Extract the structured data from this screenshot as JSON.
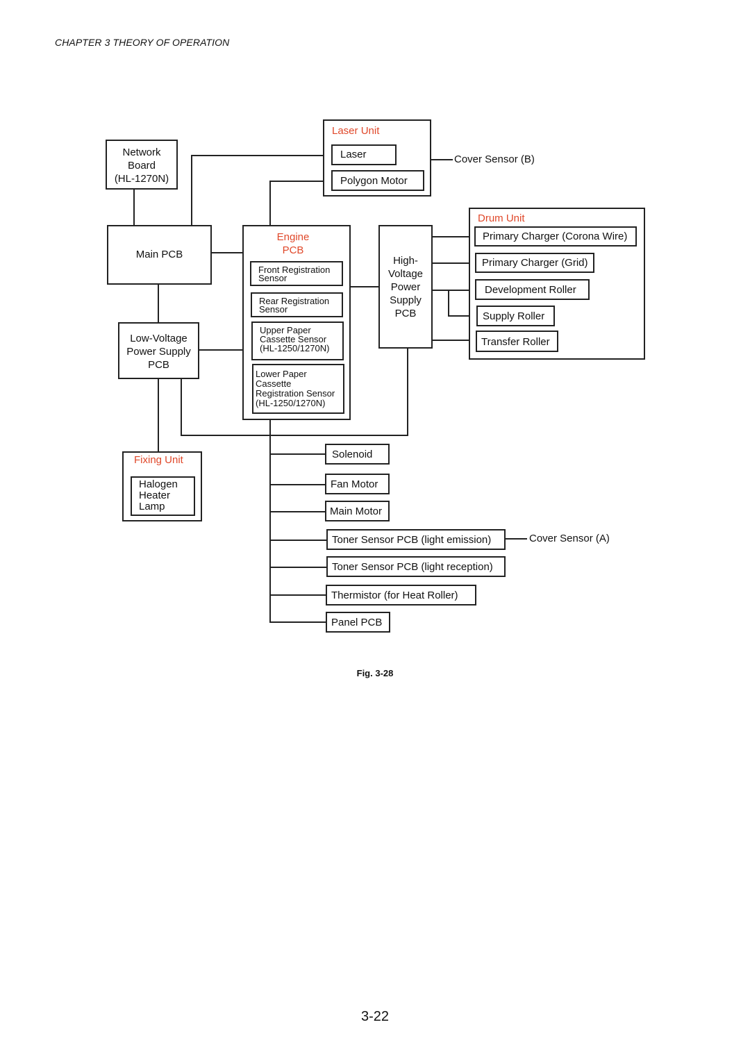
{
  "page": {
    "header": "CHAPTER 3  THEORY OF OPERATION",
    "figure_caption": "Fig. 3-28",
    "page_number": "3-22"
  },
  "colors": {
    "group_label": "#e0482a",
    "line": "#222222"
  },
  "diagram": {
    "network_board": [
      "Network",
      "Board",
      "(HL-1270N)"
    ],
    "main_pcb": "Main PCB",
    "low_voltage_psu": [
      "Low-Voltage",
      "Power Supply",
      "PCB"
    ],
    "fixing_unit": {
      "label": "Fixing Unit",
      "halogen_lamp": [
        "Halogen",
        "Heater",
        "Lamp"
      ]
    },
    "laser_unit": {
      "label": "Laser Unit",
      "laser": "Laser",
      "polygon_motor": "Polygon Motor"
    },
    "cover_sensor_b": "Cover Sensor (B)",
    "engine_pcb": {
      "label": [
        "Engine",
        "PCB"
      ],
      "sensors": [
        [
          "Front Registration",
          "Sensor"
        ],
        [
          "Rear Registration",
          "Sensor"
        ],
        [
          "Upper Paper",
          "Cassette Sensor",
          "(HL-1250/1270N)"
        ],
        [
          "Lower Paper",
          "Cassette",
          "Registration Sensor",
          "(HL-1250/1270N)"
        ]
      ]
    },
    "high_voltage_psu": [
      "High-",
      "Voltage",
      "Power",
      "Supply",
      "PCB"
    ],
    "drum_unit": {
      "label": "Drum Unit",
      "items": [
        "Primary Charger (Corona Wire)",
        "Primary Charger (Grid)",
        "Development Roller",
        "Supply Roller",
        "Transfer Roller"
      ]
    },
    "bus_items": [
      "Solenoid",
      "Fan Motor",
      "Main Motor",
      "Toner Sensor PCB (light emission)",
      "Toner Sensor PCB (light reception)",
      "Thermistor (for Heat Roller)",
      "Panel PCB"
    ],
    "cover_sensor_a": "Cover Sensor (A)"
  }
}
